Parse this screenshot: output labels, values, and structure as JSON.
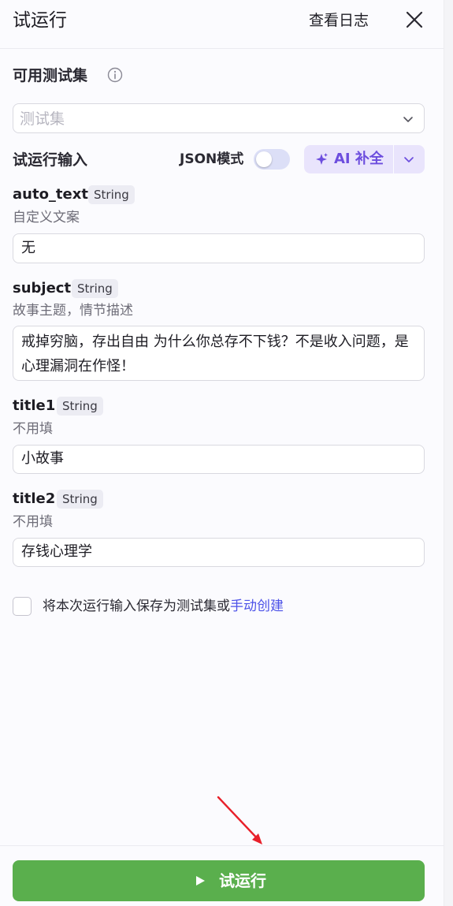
{
  "header": {
    "title": "试运行",
    "view_log_label": "查看日志"
  },
  "test_set": {
    "label": "可用测试集",
    "placeholder": "测试集"
  },
  "run_input": {
    "label": "试运行输入",
    "json_mode_label": "JSON模式",
    "json_mode_enabled": false,
    "ai_button_label": "AI 补全"
  },
  "fields": [
    {
      "name": "auto_text",
      "type": "String",
      "description": "自定义文案",
      "value": "无"
    },
    {
      "name": "subject",
      "type": "String",
      "description": "故事主题，情节描述",
      "value": "戒掉穷脑，存出自由 为什么你总存不下钱？不是收入问题，是心理漏洞在作怪！"
    },
    {
      "name": "title1",
      "type": "String",
      "description": "不用填",
      "value": "小故事"
    },
    {
      "name": "title2",
      "type": "String",
      "description": "不用填",
      "value": "存钱心理学"
    }
  ],
  "save_option": {
    "checked": false,
    "text": "将本次运行输入保存为测试集或",
    "link_text": "手动创建"
  },
  "footer": {
    "run_button_label": "试运行"
  },
  "colors": {
    "accent_green": "#5aaf4d",
    "ai_purple": "#6c4dde",
    "link_blue": "#4d53e8",
    "annotation_red": "#e8202a"
  }
}
